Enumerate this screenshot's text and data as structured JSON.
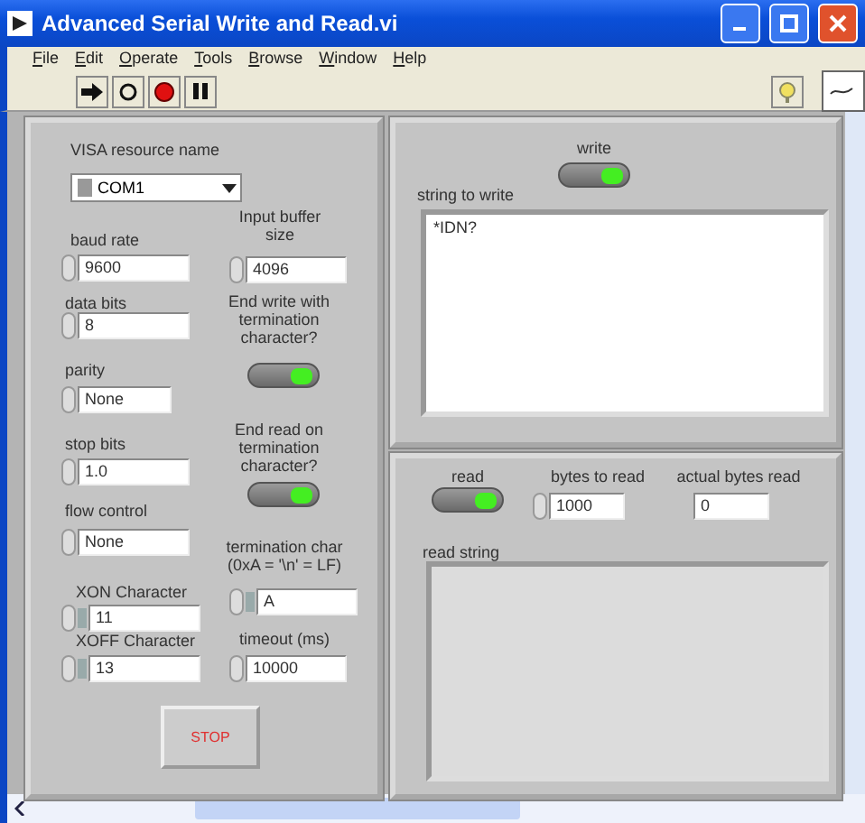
{
  "window": {
    "title": "Advanced Serial Write and Read.vi"
  },
  "menu": [
    "File",
    "Edit",
    "Operate",
    "Tools",
    "Browse",
    "Window",
    "Help"
  ],
  "left_panel": {
    "controls": [
      {
        "kind": "ring",
        "label": "VISA resource name",
        "value": "COM1"
      },
      {
        "kind": "numeric",
        "label": "baud rate",
        "value": "9600"
      },
      {
        "kind": "numeric",
        "label": "data bits",
        "value": "8"
      },
      {
        "kind": "numeric",
        "label": "parity",
        "value": "None"
      },
      {
        "kind": "numeric",
        "label": "stop bits",
        "value": "1.0"
      },
      {
        "kind": "numeric",
        "label": "flow control",
        "value": "None"
      },
      {
        "kind": "hex",
        "label": "XON Character",
        "value": "11"
      },
      {
        "kind": "hex",
        "label": "XOFF Character",
        "value": "13"
      },
      {
        "kind": "numeric",
        "label": "Input buffer size",
        "value": "4096"
      },
      {
        "kind": "led",
        "label": "End write with termination character?",
        "on": true
      },
      {
        "kind": "led",
        "label": "End read on termination character?",
        "on": true
      },
      {
        "kind": "hex",
        "label": "termination char (0xA = '\\n' = LF)",
        "value": "A"
      },
      {
        "kind": "numeric",
        "label": "timeout (ms)",
        "value": "10000"
      },
      {
        "kind": "button",
        "label": "STOP"
      }
    ]
  },
  "write_panel": {
    "controls": [
      {
        "kind": "led",
        "label": "write",
        "on": true
      },
      {
        "kind": "text",
        "label": "string to write",
        "value": "*IDN?"
      }
    ]
  },
  "read_panel": {
    "controls": [
      {
        "kind": "led",
        "label": "read",
        "on": true
      },
      {
        "kind": "numeric",
        "label": "bytes to read",
        "value": "1000"
      },
      {
        "kind": "indicator",
        "label": "actual bytes read",
        "value": "0"
      },
      {
        "kind": "display",
        "label": "read string"
      }
    ]
  }
}
